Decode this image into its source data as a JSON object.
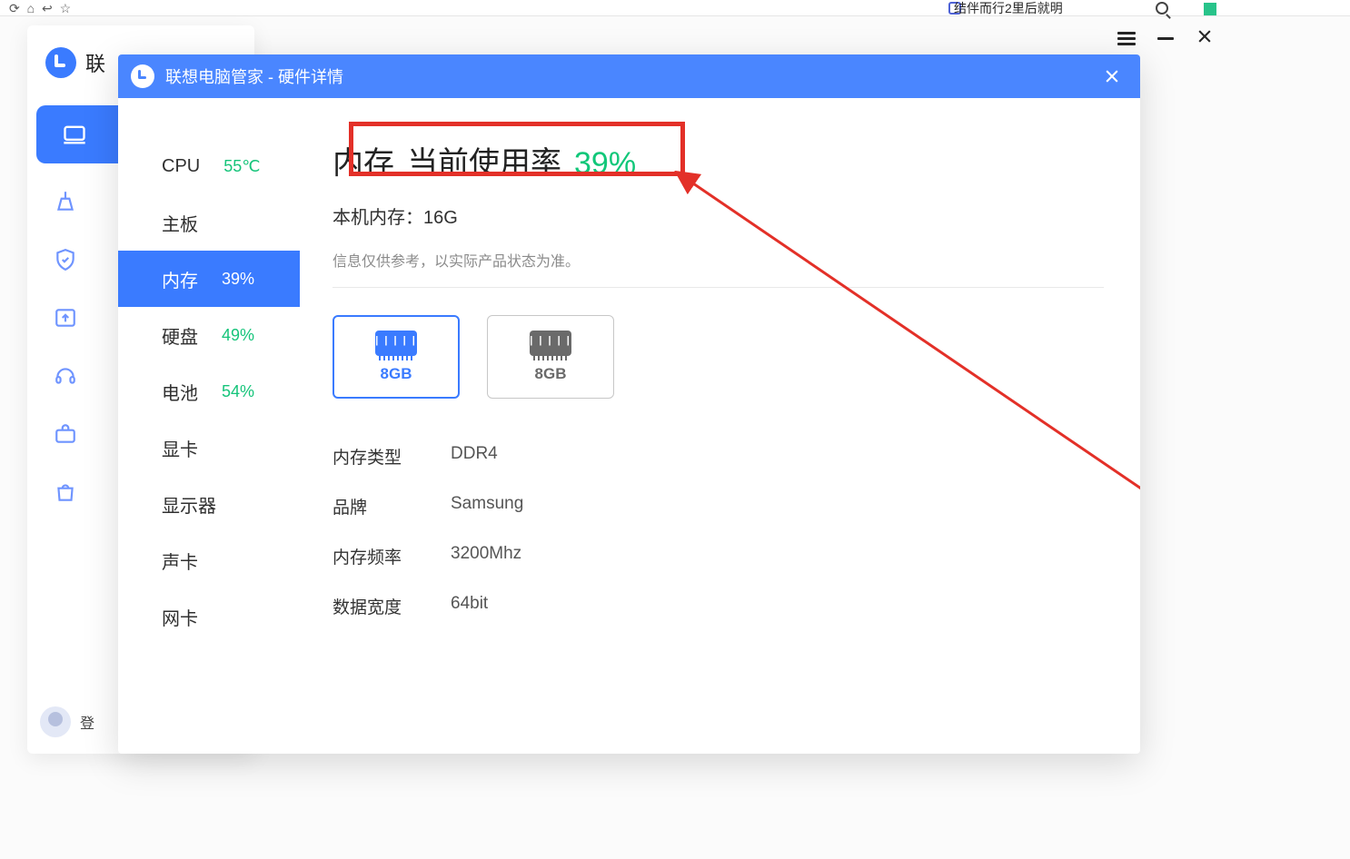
{
  "parentApp": {
    "title": "联",
    "menu": {
      "dashboard": "",
      "clean": "",
      "guard": "",
      "upload": "",
      "support": "",
      "toolbox": "",
      "store": ""
    },
    "profileLabel": "登"
  },
  "dialog": {
    "title": "联想电脑管家 - 硬件详情",
    "sidebar": [
      {
        "label": "CPU",
        "value": "55℃"
      },
      {
        "label": "主板",
        "value": ""
      },
      {
        "label": "内存",
        "value": "39%"
      },
      {
        "label": "硬盘",
        "value": "49%"
      },
      {
        "label": "电池",
        "value": "54%"
      },
      {
        "label": "显卡",
        "value": ""
      },
      {
        "label": "显示器",
        "value": ""
      },
      {
        "label": "声卡",
        "value": ""
      },
      {
        "label": "网卡",
        "value": ""
      }
    ],
    "heading": {
      "t1": "内存",
      "t2": "当前使用率",
      "pct": "39%"
    },
    "subline": "本机内存：16G",
    "note": "信息仅供参考，以实际产品状态为准。",
    "cards": [
      {
        "cap": "8GB"
      },
      {
        "cap": "8GB"
      }
    ],
    "specs": [
      {
        "k": "内存类型",
        "v": "DDR4"
      },
      {
        "k": "品牌",
        "v": "Samsung"
      },
      {
        "k": "内存频率",
        "v": "3200Mhz"
      },
      {
        "k": "数据宽度",
        "v": "64bit"
      }
    ]
  },
  "bgTabText": "结伴而行2里后就明"
}
